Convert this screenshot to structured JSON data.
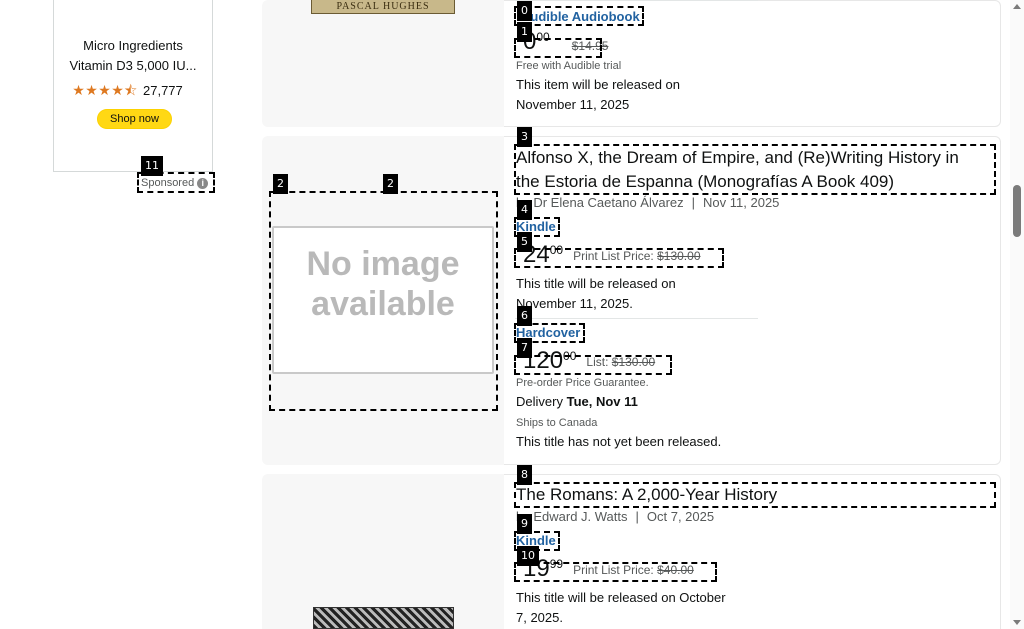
{
  "ad": {
    "title_line1": "Micro Ingredients",
    "title_line2": "Vitamin D3 5,000 IU...",
    "rating_count": "27,777",
    "shop_button": "Shop now",
    "sponsored": "Sponsored",
    "tag": "11"
  },
  "result0": {
    "cover_author": "PASCAL HUGHES",
    "format": "Audible Audiobook",
    "price_whole": "0",
    "price_frac": "00",
    "list_price": "$14.95",
    "trial_note": "Free with Audible trial",
    "release_line1": "This item will be released on",
    "release_line2": "November 11, 2025",
    "tag_format": "0",
    "tag_price": "1"
  },
  "result1": {
    "image_placeholder": "No image available",
    "title_line1": "Alfonso X, the Dream of Empire, and (Re)Writing History in",
    "title_line2": "the Estoria de Espanna (Monografías A Book 409)",
    "byline_author": "by Dr Elena Caetano Álvarez",
    "byline_date": "Nov 11, 2025",
    "kindle_format": "Kindle",
    "kindle_whole": "24",
    "kindle_frac": "00",
    "kindle_list_label": "Print List Price:",
    "kindle_list": "$130.00",
    "kindle_release_line1": "This title will be released on",
    "kindle_release_line2": "November 11, 2025.",
    "hardcover_format": "Hardcover",
    "hardcover_whole": "120",
    "hardcover_frac": "00",
    "hardcover_list_label": "List:",
    "hardcover_list": "$130.00",
    "preorder": "Pre-order Price Guarantee.",
    "delivery_label": "Delivery",
    "delivery_date": "Tue, Nov 11",
    "ships": "Ships to Canada",
    "not_released": "This title has not yet been released.",
    "tag_title": "3",
    "tag_img_a": "2",
    "tag_img_b": "2",
    "tag_kindle": "4",
    "tag_kindle_price": "5",
    "tag_hardcover": "6",
    "tag_hardcover_price": "7"
  },
  "result2": {
    "title": "The Romans: A 2,000-Year History",
    "byline_author": "by Edward J. Watts",
    "byline_date": "Oct 7, 2025",
    "kindle_format": "Kindle",
    "kindle_whole": "19",
    "kindle_frac": "99",
    "kindle_list_label": "Print List Price:",
    "kindle_list": "$40.00",
    "release_line1": "This title will be released on October",
    "release_line2": "7, 2025.",
    "tag_title": "8",
    "tag_kindle": "9",
    "tag_price": "10"
  }
}
